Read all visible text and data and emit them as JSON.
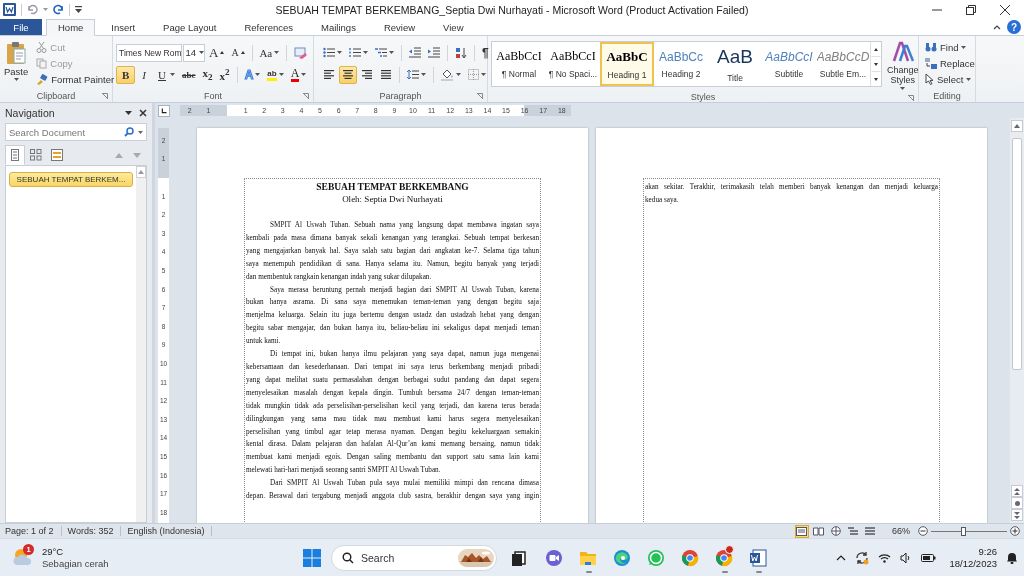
{
  "window": {
    "title": "SEBUAH TEMPAT BERKEMBANG_Septia Dwi Nurhayati  -  Microsoft Word (Product Activation Failed)",
    "help": "?"
  },
  "ribbon_tabs": [
    {
      "label": "File",
      "kind": "file",
      "selected": false
    },
    {
      "label": "Home",
      "kind": "tab",
      "selected": true
    },
    {
      "label": "Insert",
      "kind": "tab",
      "selected": false
    },
    {
      "label": "Page Layout",
      "kind": "tab",
      "selected": false
    },
    {
      "label": "References",
      "kind": "tab",
      "selected": false
    },
    {
      "label": "Mailings",
      "kind": "tab",
      "selected": false
    },
    {
      "label": "Review",
      "kind": "tab",
      "selected": false
    },
    {
      "label": "View",
      "kind": "tab",
      "selected": false
    }
  ],
  "ribbon": {
    "clipboard": {
      "label": "Clipboard",
      "paste": "Paste",
      "items": [
        {
          "kind": "cut",
          "label": "Cut",
          "disabled": true
        },
        {
          "kind": "copy",
          "label": "Copy",
          "disabled": true
        },
        {
          "kind": "painter",
          "label": "Format Painter",
          "disabled": false
        }
      ]
    },
    "font": {
      "label": "Font",
      "name": "Times New Rom",
      "size": "14",
      "row1": [
        {
          "kind": "grow",
          "label": "A"
        },
        {
          "kind": "shrink",
          "label": "A"
        },
        {
          "kind": "case",
          "label": "Aa"
        },
        {
          "kind": "clear"
        }
      ],
      "row2": [
        {
          "kind": "bold",
          "label": "B",
          "selected": true
        },
        {
          "kind": "italic",
          "label": "I",
          "selected": false
        },
        {
          "kind": "underline",
          "label": "U",
          "selected": false
        },
        {
          "kind": "strike",
          "label": "abc",
          "selected": false
        },
        {
          "kind": "sub",
          "label": "x$_{2}$",
          "selected": false
        },
        {
          "kind": "super",
          "label": "x$^{2}$",
          "selected": false
        },
        {
          "kind": "effects",
          "label": "A",
          "selected": false
        },
        {
          "kind": "highlight",
          "label": "ab",
          "selected": false
        },
        {
          "kind": "color",
          "label": "A",
          "selected": false
        }
      ]
    },
    "paragraph": {
      "label": "Paragraph",
      "show_marks": "¶",
      "alignment": [
        {
          "kind": "left",
          "selected": false
        },
        {
          "kind": "center",
          "selected": true
        },
        {
          "kind": "right",
          "selected": false
        },
        {
          "kind": "justify",
          "selected": false
        }
      ]
    },
    "styles": {
      "label": "Styles",
      "change_styles": "Change Styles",
      "gallery": [
        {
          "kind": "normal",
          "preview": "AaBbCcI",
          "name": "¶ Normal",
          "selected": false
        },
        {
          "kind": "nospacing",
          "preview": "AaBbCcI",
          "name": "¶ No Spaci...",
          "selected": false
        },
        {
          "kind": "heading1",
          "preview": "AaBbC",
          "name": "Heading 1",
          "selected": true
        },
        {
          "kind": "heading2",
          "preview": "AaBbCc",
          "name": "Heading 2",
          "selected": false
        },
        {
          "kind": "title",
          "preview": "AaB",
          "name": "Title",
          "selected": false
        },
        {
          "kind": "subtitle",
          "preview": "AaBbCcI",
          "name": "Subtitle",
          "selected": false
        },
        {
          "kind": "emphasis",
          "preview": "AaBbCcD",
          "name": "Subtle Em...",
          "selected": false
        }
      ]
    },
    "editing": {
      "label": "Editing",
      "find": "Find",
      "replace": "Replace",
      "select": "Select"
    }
  },
  "navigation": {
    "title": "Navigation",
    "search_placeholder": "Search Document",
    "view_tabs": [
      {
        "kind": "headings",
        "selected": true
      },
      {
        "kind": "pages",
        "selected": false
      },
      {
        "kind": "results",
        "selected": false
      }
    ],
    "headings": [
      {
        "label": "SEBUAH TEMPAT BERKEM...",
        "selected": true
      }
    ]
  },
  "ruler": {
    "horizontal": {
      "before": [
        "2",
        "1"
      ],
      "after": [
        "1",
        "2",
        "3",
        "4",
        "5",
        "6",
        "7",
        "8",
        "9",
        "10",
        "11",
        "12",
        "13",
        "14",
        "15",
        "16",
        "17",
        "18"
      ]
    },
    "vertical": {
      "before": [
        "2",
        "1"
      ],
      "after": [
        "1",
        "2",
        "3",
        "4",
        "5",
        "6",
        "7",
        "8",
        "9",
        "10",
        "11",
        "12",
        "13",
        "14",
        "15",
        "16",
        "17",
        "18"
      ]
    }
  },
  "pages": [
    {
      "title": "SEBUAH TEMPAT BERKEMBANG",
      "byline": "Oleh: Septia Dwi Nurhayati",
      "paragraphs": [
        {
          "indent": true,
          "continues": false,
          "lines": [
            "SMPIT Al Uswah Tuban. Sebuah nama yang langsung dapat membawa ingatan saya",
            "kembali pada masa dimana banyak sekali kenangan yang terangkai. Sebuah tempat berkesan",
            "yang mengajarkan banyak hal. Saya salah satu bagian dari angkatan ke-7. Selama tiga tahun",
            "saya menempuh pendidikan di sana. Hanya selama itu. Namun, begitu banyak yang terjadi",
            "dan membentuk rangkain kenangan indah yang sukar dilupakan."
          ]
        },
        {
          "indent": true,
          "continues": false,
          "lines": [
            "Saya merasa beruntung pernah menjadi bagian dari SMPIT Al Uswah Tuban, karena",
            "bukan hanya asrama. Di sana saya menemukan teman-teman yang dengan begitu saja",
            "menjelma keluarga. Selain itu juga bertemu dengan ustadz dan ustadzah hebat yang dengan",
            "begitu sabar mengajar, dan bukan hanya itu, beliau-beliau ini sekaligus dapat menjadi teman",
            "untuk kami."
          ]
        },
        {
          "indent": true,
          "continues": false,
          "lines": [
            "Di tempat ini, bukan hanya ilmu pelajaran yang saya dapat, namun juga mengenai",
            "kebersamaan dan kesederhanaan. Dari tempat ini saya terus berkembang menjadi pribadi",
            "yang dapat melihat suatu permasalahan dengan berbagai sudut pandang dan dapat segera",
            "menyelesaikan masalah dengan kepala dingin. Tumbuh bersama 24/7 dengan teman-teman",
            "tidak mungkin tidak ada perselisihan-perselisihan kecil yang terjadi, dan karena terus berada",
            "dilingkungan yang sama mau tidak mau membuat kami harus segera menyelesaikan",
            "perselisihan yang timbul agar tetap merasa nyaman. Dengan begitu kekeluargaan semakin",
            "kental dirasa. Dalam pelajaran dan hafalan Al-Qur’an kami memang bersaing, namun tidak",
            "membuat kami menjadi egois. Dengan saling membantu dan support satu sama lain kami",
            "melewati hari-hari menjadi seorang santri SMPIT Al Uswah Tuban."
          ]
        },
        {
          "indent": true,
          "continues": true,
          "lines": [
            "Dari SMPIT Al Uswah Tuban pula saya mulai memiliki mimpi dan rencana dimasa",
            "depan. Berawal dari tergabung menjadi anggota club sastra, berakhir dengan saya yang ingin"
          ]
        }
      ]
    },
    {
      "paragraphs": [
        {
          "indent": false,
          "continues": false,
          "lines": [
            "akan sekitar. Terakhir, terimakasih telah memberi banyak kenangan dan menjadi keluarga",
            "kedua saya."
          ]
        }
      ]
    }
  ],
  "status_bar": {
    "page": "Page: 1 of 2",
    "words": "Words: 352",
    "language": "English (Indonesia)",
    "views": [
      {
        "kind": "print",
        "selected": true
      },
      {
        "kind": "reading",
        "selected": false
      },
      {
        "kind": "web",
        "selected": false
      },
      {
        "kind": "outline",
        "selected": false
      },
      {
        "kind": "draft",
        "selected": false
      }
    ],
    "zoom": "66%",
    "zoom_slider": {
      "level": 0.42
    }
  },
  "taskbar": {
    "weather": {
      "badge": "1",
      "temperature": "29°C",
      "condition": "Sebagian cerah"
    },
    "search": "Search",
    "apps": [
      {
        "kind": "taskview",
        "running": false,
        "badge": false
      },
      {
        "kind": "meet",
        "running": false,
        "badge": false
      },
      {
        "kind": "explorer",
        "running": true,
        "badge": false
      },
      {
        "kind": "edge",
        "running": false,
        "badge": false
      },
      {
        "kind": "whatsapp",
        "running": false,
        "badge": false
      },
      {
        "kind": "chrome",
        "running": false,
        "badge": false
      },
      {
        "kind": "chrome",
        "running": true,
        "badge": true
      },
      {
        "kind": "word",
        "running": true,
        "badge": false
      }
    ],
    "time": "9:26",
    "date": "18/12/2023"
  }
}
